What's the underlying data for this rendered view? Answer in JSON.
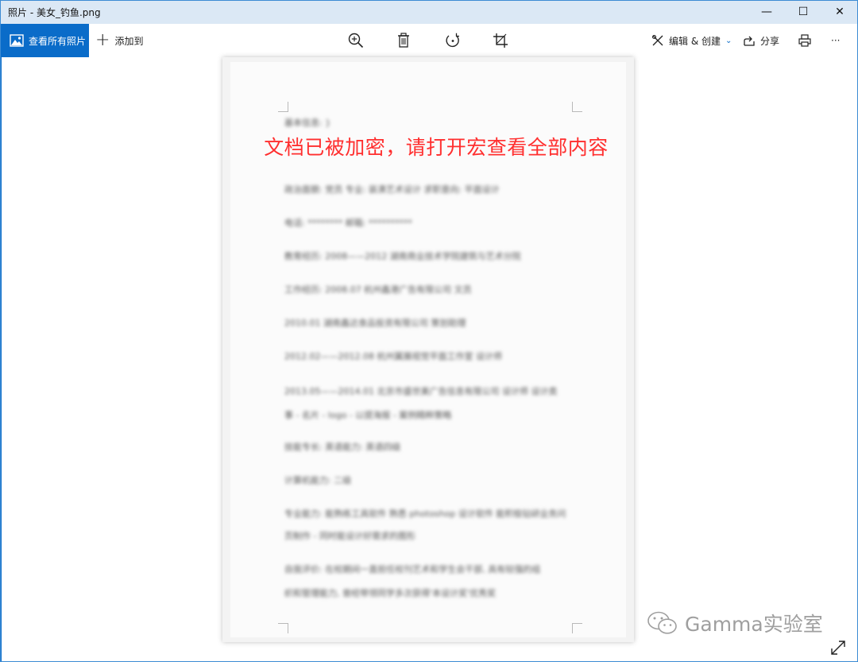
{
  "window": {
    "title": "照片 - 美女_钓鱼.png",
    "controls": {
      "minimize": "—",
      "maximize": "☐",
      "close": "✕"
    }
  },
  "toolbar": {
    "view_all_label": "查看所有照片",
    "add_to_label": "添加到",
    "edit_create_label": "编辑 & 创建",
    "share_label": "分享",
    "more_label": "···"
  },
  "document": {
    "warning_text": "文档已被加密，请打开宏查看全部内容",
    "blurred_lines": [
      "基本信息: }",
      "",
      "政治面貌: 党员  专业: 装潢艺术设计  求职意向: 平面设计",
      "电话: ********  邮箱: **********",
      "教育经历: 2008——2012  湖南商业技术学院建筑与艺术分院",
      "工作经历: 2008.07  杭州鑫港广告有限公司  文员",
      "2010.01  湖南鑫达食品投资有限公司  策划助理",
      "2012.02——2012.08  杭州翼展视觉平面工作室  设计师",
      "2013.05——2014.01  北京市盛世美广告信息有限公司  设计师  设计类",
      "事 - 名片 - logo - 以提海报 - 案例精粹策略",
      "技能专长: 英语能力: 英语四级",
      "计算机能力: 二级",
      "专业能力: 能熟练工具软件  熟悉 photoshop 设计软件  能积极钻研业务问",
      "页制作 - 同时能设计好需求的图形",
      "自我评价: 在校期间一直担任校刊艺术和学生会干部, 具有较强的组",
      "织和管理能力, 曾经带领同学多次获得'本设计奖'优秀奖"
    ]
  },
  "watermark": {
    "text": "Gamma实验室"
  },
  "colors": {
    "accent": "#0a6cc9",
    "titlebar_bg": "#dbe8f5",
    "warning_red": "#ff2f2f"
  },
  "icons": {
    "zoom": "zoom-in-icon",
    "delete": "trash-icon",
    "rotate": "rotate-icon",
    "crop": "crop-icon",
    "edit": "edit-create-icon",
    "share": "share-icon",
    "print": "print-icon",
    "expand": "expand-icon"
  }
}
